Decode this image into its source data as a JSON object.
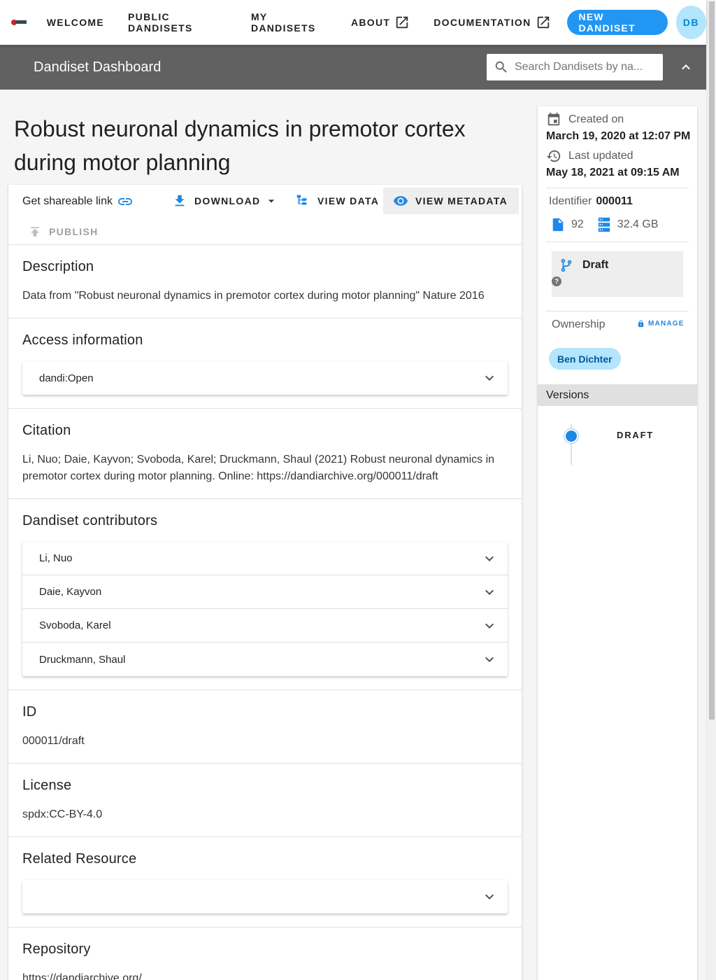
{
  "nav": {
    "items": [
      "WELCOME",
      "PUBLIC DANDISETS",
      "MY DANDISETS",
      "ABOUT",
      "DOCUMENTATION"
    ],
    "new_button": "NEW DANDISET",
    "avatar_initials": "DB"
  },
  "dashboard": {
    "title": "Dandiset Dashboard",
    "search_placeholder": "Search Dandisets by na..."
  },
  "dandiset": {
    "title": "Robust neuronal dynamics in premotor cortex during motor planning",
    "actions": {
      "share": "Get shareable link",
      "download": "DOWNLOAD",
      "view_data": "VIEW DATA",
      "view_metadata": "VIEW METADATA",
      "publish": "PUBLISH"
    },
    "sections": {
      "description": {
        "heading": "Description",
        "text": "Data from \"Robust neuronal dynamics in premotor cortex during motor planning\" Nature 2016"
      },
      "access": {
        "heading": "Access information",
        "value": "dandi:Open"
      },
      "citation": {
        "heading": "Citation",
        "text": "Li, Nuo; Daie, Kayvon; Svoboda, Karel; Druckmann, Shaul (2021) Robust neuronal dynamics in premotor cortex during motor planning. Online: https://dandiarchive.org/000011/draft"
      },
      "contributors": {
        "heading": "Dandiset contributors",
        "names": [
          "Li, Nuo",
          "Daie, Kayvon",
          "Svoboda, Karel",
          "Druckmann, Shaul"
        ]
      },
      "id": {
        "heading": "ID",
        "value": "000011/draft"
      },
      "license": {
        "heading": "License",
        "value": "spdx:CC-BY-4.0"
      },
      "related": {
        "heading": "Related Resource",
        "value": ""
      },
      "repository": {
        "heading": "Repository",
        "value": "https://dandiarchive.org/"
      }
    }
  },
  "sidebar": {
    "created_label": "Created on",
    "created_value": "March 19, 2020 at 12:07 PM",
    "updated_label": "Last updated",
    "updated_value": "May 18, 2021 at 09:15 AM",
    "identifier_label": "Identifier",
    "identifier_value": "000011",
    "file_count": "92",
    "size": "32.4 GB",
    "version_status": "Draft",
    "ownership_label": "Ownership",
    "manage_label": "MANAGE",
    "owner": "Ben Dichter",
    "versions_label": "Versions",
    "version_item": "DRAFT"
  },
  "colors": {
    "primary": "#2196f3",
    "toolbar": "#616161",
    "chip_bg": "#b3e5fc",
    "link_icon": "#1e88e5"
  },
  "icons": [
    "external-link-icon",
    "search-icon",
    "chevron-up-icon",
    "link-icon",
    "download-icon",
    "caret-down-icon",
    "file-tree-icon",
    "eye-icon",
    "publish-icon",
    "chevron-down-icon",
    "calendar-icon",
    "history-icon",
    "file-icon",
    "storage-icon",
    "branch-icon",
    "help-icon",
    "lock-icon"
  ]
}
